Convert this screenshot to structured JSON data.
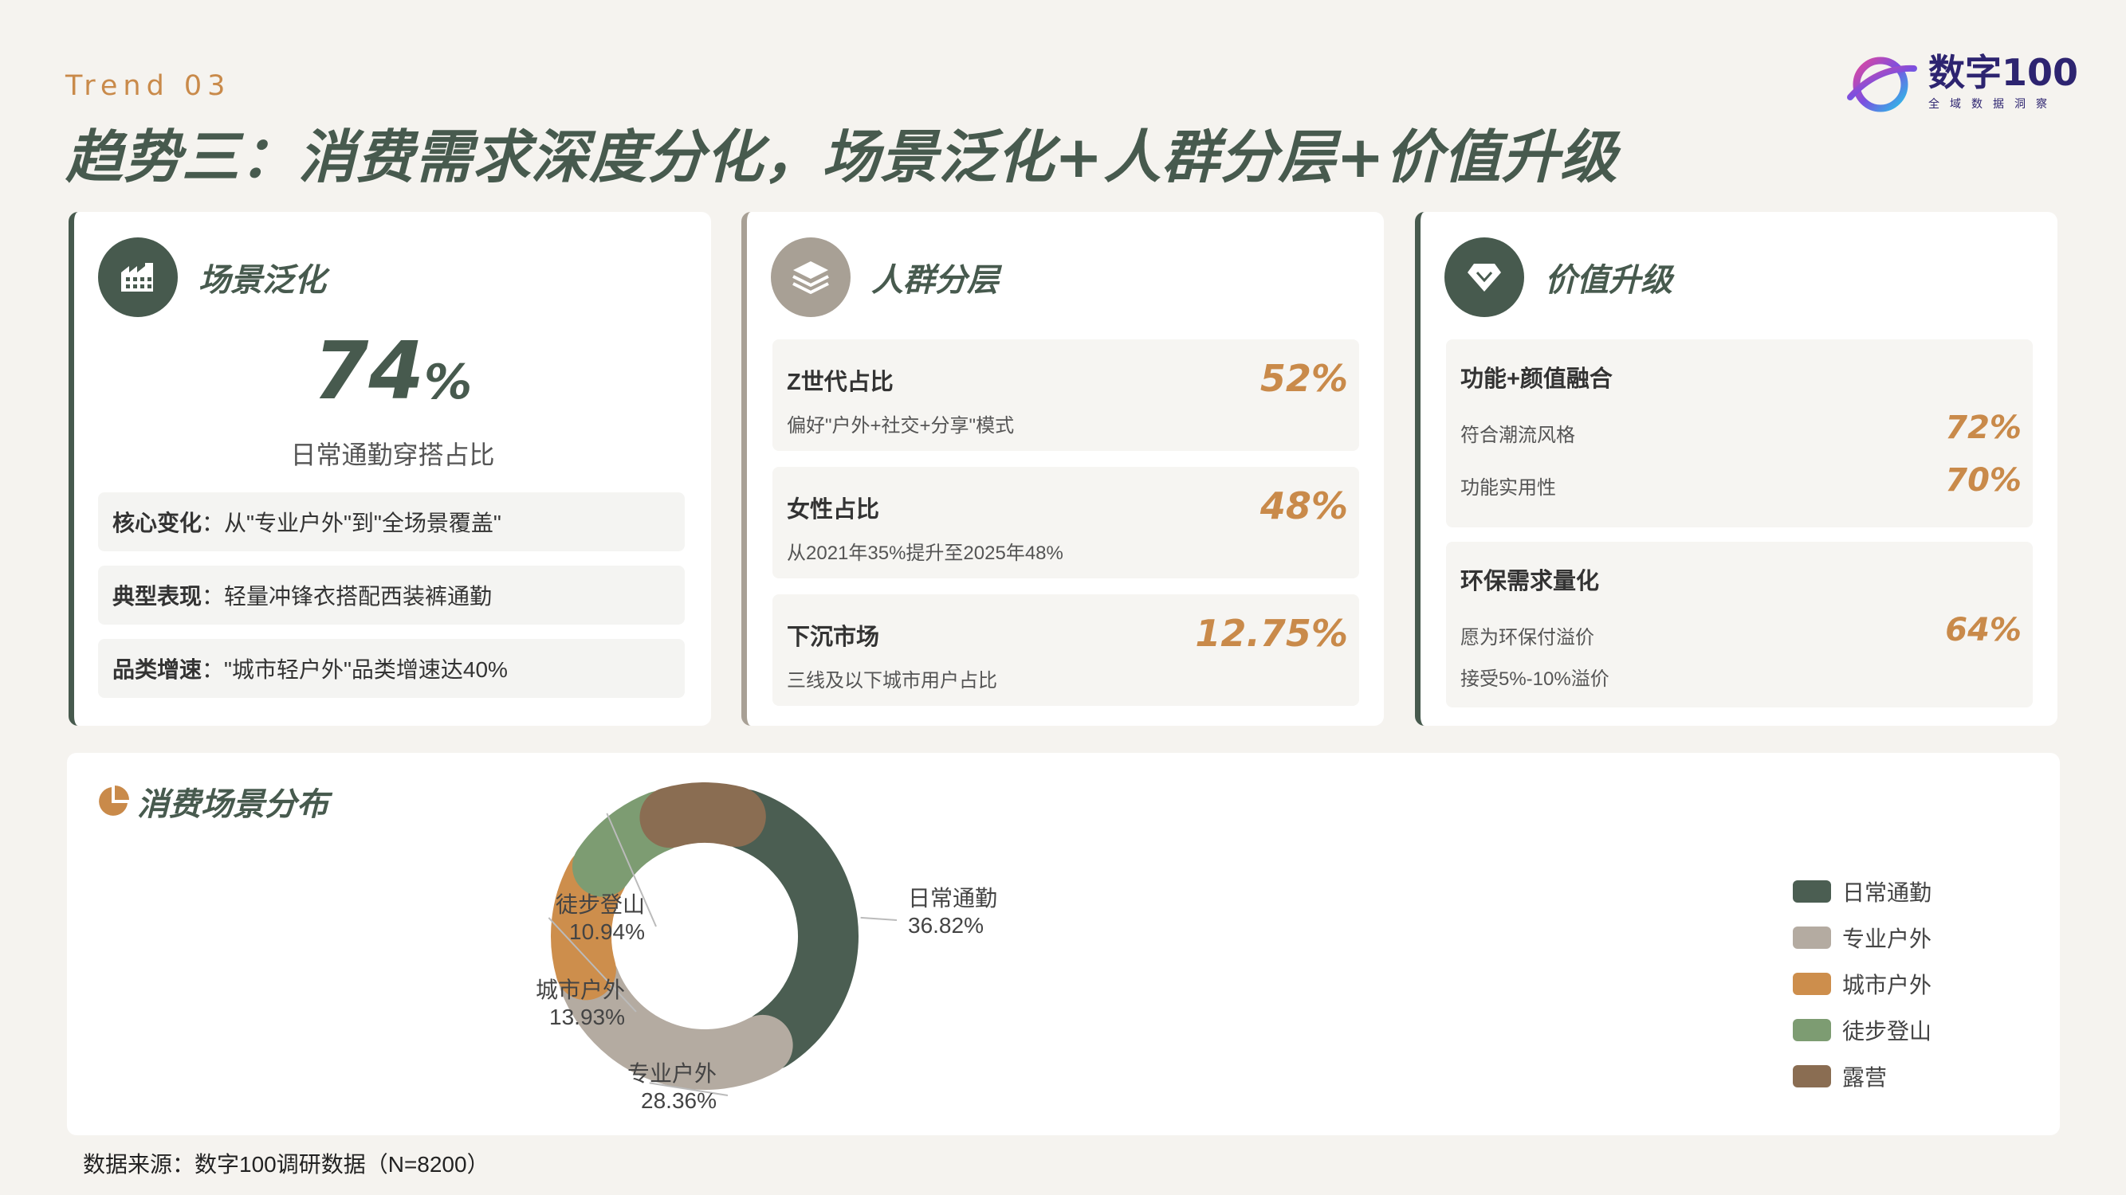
{
  "header": {
    "trend_label": "Trend 03",
    "title": "趋势三：消费需求深度分化，场景泛化+人群分层+价值升级"
  },
  "logo": {
    "name": "数字100",
    "sub": "全域数据洞察"
  },
  "card_scene": {
    "title": "场景泛化",
    "icon": "factory-icon",
    "big_value": "74",
    "big_unit": "%",
    "caption": "日常通勤穿搭占比",
    "rows": [
      {
        "key": "核心变化",
        "text": "：从\"专业户外\"到\"全场景覆盖\""
      },
      {
        "key": "典型表现",
        "text": "：轻量冲锋衣搭配西装裤通勤"
      },
      {
        "key": "品类增速",
        "text": "：\"城市轻户外\"品类增速达40%"
      }
    ]
  },
  "card_crowd": {
    "title": "人群分层",
    "icon": "layers-icon",
    "stats": [
      {
        "title": "Z世代占比",
        "sub": "偏好\"户外+社交+分享\"模式",
        "value": "52%"
      },
      {
        "title": "女性占比",
        "sub": "从2021年35%提升至2025年48%",
        "value": "48%"
      },
      {
        "title": "下沉市场",
        "sub": "三线及以下城市用户占比",
        "value": "12.75%"
      }
    ]
  },
  "card_value": {
    "title": "价值升级",
    "icon": "diamond-icon",
    "box1": {
      "title": "功能+颜值融合",
      "lines": [
        {
          "label": "符合潮流风格",
          "value": "72%"
        },
        {
          "label": "功能实用性",
          "value": "70%"
        }
      ]
    },
    "box2": {
      "title": "环保需求量化",
      "lines": [
        {
          "label": "愿为环保付溢价",
          "value": "64%"
        },
        {
          "label": "接受5%-10%溢价",
          "value": ""
        }
      ]
    }
  },
  "chart_section": {
    "title": "消费场景分布",
    "icon": "pie-chart-icon"
  },
  "chart_data": {
    "type": "pie",
    "title": "消费场景分布",
    "series": [
      {
        "name": "日常通勤",
        "value": 36.82,
        "label": "36.82%",
        "color": "#4b5e52"
      },
      {
        "name": "专业户外",
        "value": 28.36,
        "label": "28.36%",
        "color": "#b4aba1"
      },
      {
        "name": "城市户外",
        "value": 13.93,
        "label": "13.93%",
        "color": "#cd8e4c"
      },
      {
        "name": "徒步登山",
        "value": 10.94,
        "label": "10.94%",
        "color": "#7d9c72"
      },
      {
        "name": "露营",
        "value": 9.95,
        "label": "",
        "color": "#8a6d52"
      }
    ],
    "legend": "right"
  },
  "source": "数据来源：数字100调研数据（N=8200）"
}
